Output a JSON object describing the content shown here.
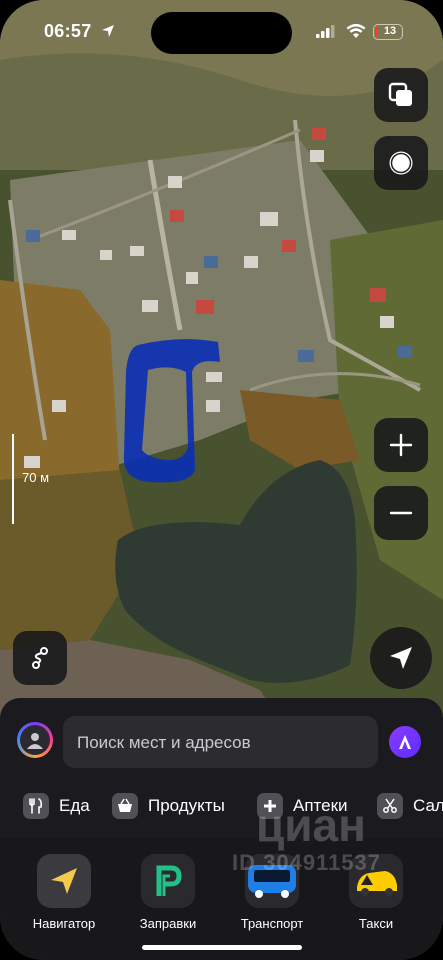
{
  "status_bar": {
    "time": "06:57",
    "battery": "13"
  },
  "map": {
    "scale_label": "70 м"
  },
  "search": {
    "placeholder": "Поиск мест и адресов"
  },
  "categories": [
    {
      "label": "Еда",
      "icon": "fork-knife-icon"
    },
    {
      "label": "Продукты",
      "icon": "basket-icon"
    },
    {
      "label": "Аптеки",
      "icon": "plus-icon"
    },
    {
      "label": "Сал",
      "icon": "scissors-icon"
    }
  ],
  "dock": [
    {
      "label": "Навигатор",
      "icon": "navigator-icon"
    },
    {
      "label": "Заправки",
      "icon": "fuel-icon"
    },
    {
      "label": "Транспорт",
      "icon": "transport-icon"
    },
    {
      "label": "Такси",
      "icon": "taxi-icon"
    }
  ],
  "watermark": {
    "brand": "циан",
    "id": "ID 304911537"
  },
  "colors": {
    "accent_purple": "#7a3cff",
    "marker_blue": "#0a2fb5",
    "taxi_yellow": "#ffcc00",
    "fuel_green": "#21c28a"
  }
}
